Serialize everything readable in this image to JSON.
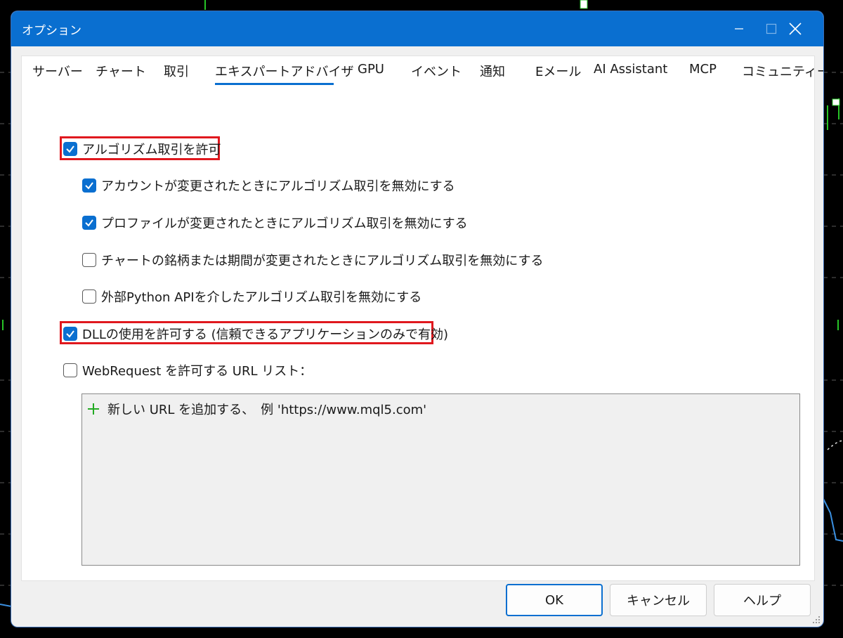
{
  "window": {
    "title": "オプション"
  },
  "tabs": [
    {
      "label": "サーバー"
    },
    {
      "label": "チャート"
    },
    {
      "label": "取引"
    },
    {
      "label": "エキスパートアドバイザ",
      "selected": true
    },
    {
      "label": "GPU"
    },
    {
      "label": "イベント"
    },
    {
      "label": "通知"
    },
    {
      "label": "Eメール"
    },
    {
      "label": "AI Assistant"
    },
    {
      "label": "MCP"
    },
    {
      "label": "コミュニティー"
    }
  ],
  "options": {
    "allow_algo": {
      "label": "アルゴリズム取引を許可",
      "checked": true,
      "highlighted": true
    },
    "disable_on_account": {
      "label": "アカウントが変更されたときにアルゴリズム取引を無効にする",
      "checked": true
    },
    "disable_on_profile": {
      "label": "プロファイルが変更されたときにアルゴリズム取引を無効にする",
      "checked": true
    },
    "disable_on_chart": {
      "label": "チャートの銘柄または期間が変更されたときにアルゴリズム取引を無効にする",
      "checked": false
    },
    "disable_python": {
      "label": "外部Python APIを介したアルゴリズム取引を無効にする",
      "checked": false
    },
    "allow_dll": {
      "label": "DLLの使用を許可する (信頼できるアプリケーションのみで有効)",
      "checked": true,
      "highlighted": true
    },
    "allow_webrequest": {
      "label": "WebRequest を許可する URL リスト：",
      "checked": false
    }
  },
  "url_list": {
    "add_label": "新しい URL を追加する、　例 'https://www.mql5.com'",
    "add_icon": "plus-icon"
  },
  "buttons": {
    "ok": "OK",
    "cancel": "キャンセル",
    "help": "ヘルプ"
  },
  "colors": {
    "accent": "#0a6fd0",
    "highlight": "#e0181e",
    "plus": "#22aa22"
  }
}
